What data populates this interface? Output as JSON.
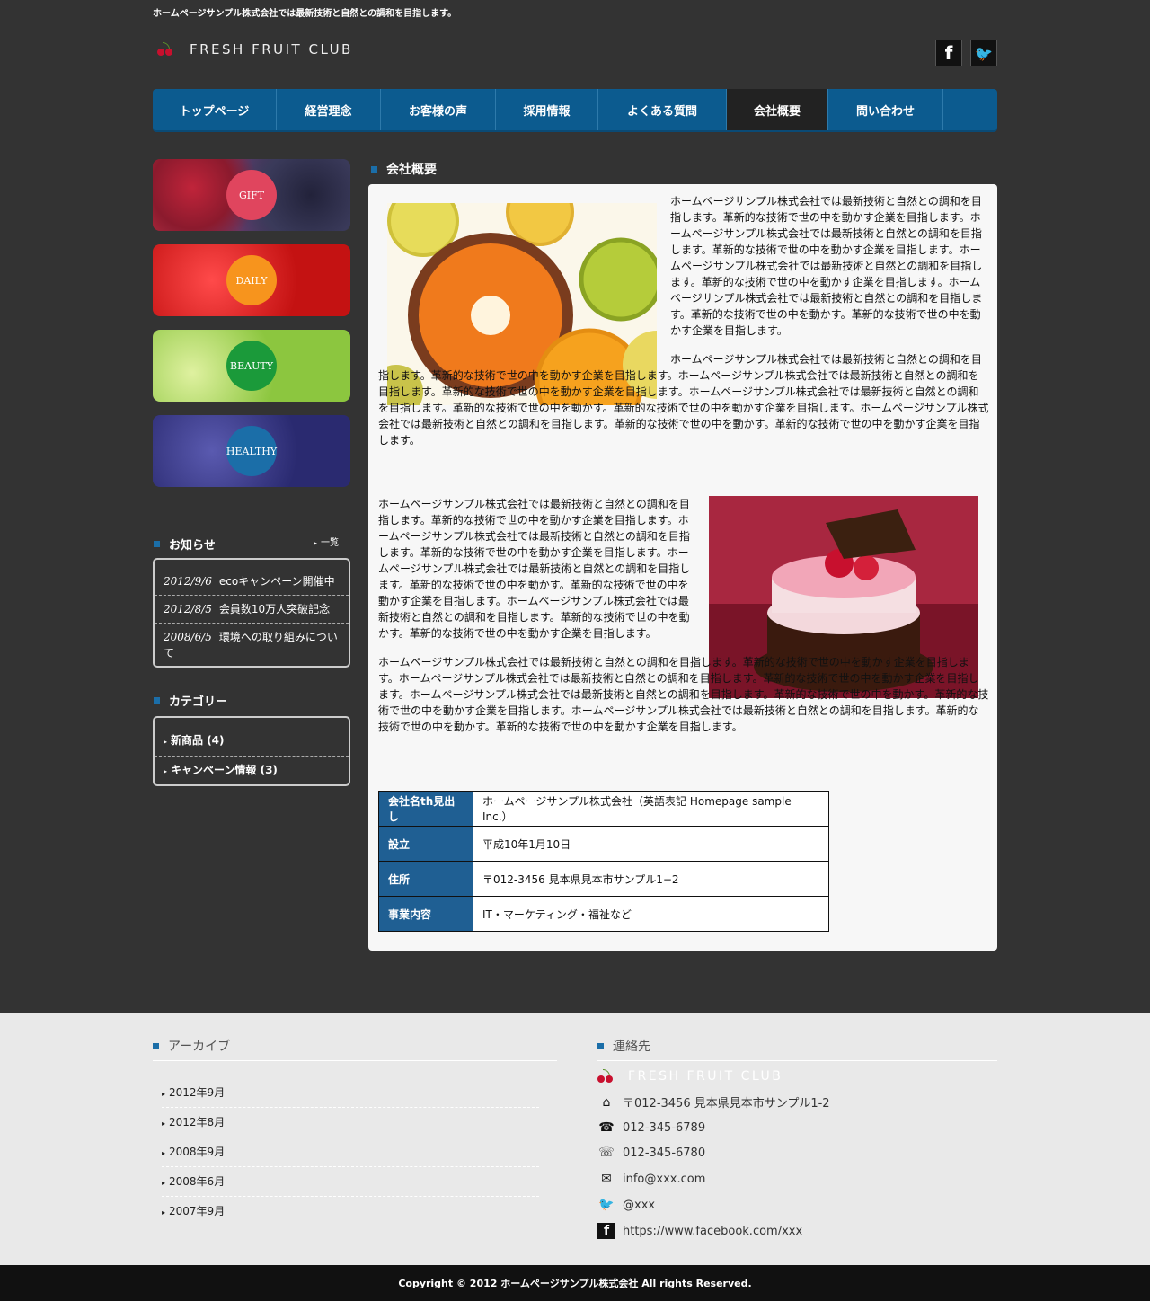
{
  "header": {
    "tagline": "ホームページサンプル株式会社では最新技術と自然との調和を目指します。",
    "logo": "FRESH FRUIT CLUB",
    "facebook": "f",
    "twitter": "🐦"
  },
  "nav": [
    {
      "label": "トップページ",
      "w": 138
    },
    {
      "label": "経営理念",
      "w": 116
    },
    {
      "label": "お客様の声",
      "w": 128
    },
    {
      "label": "採用情報",
      "w": 114
    },
    {
      "label": "よくある質問",
      "w": 143
    },
    {
      "label": "会社概要",
      "w": 113
    },
    {
      "label": "問い合わせ",
      "w": 128
    }
  ],
  "banners": {
    "gift": "GIFT",
    "daily": "DAILY",
    "beauty": "BEAUTY",
    "healthy": "HEALTHY"
  },
  "news": {
    "title": "お知らせ",
    "more": "一覧",
    "items": [
      {
        "date": "2012/9/6",
        "text": "ecoキャンペーン開催中"
      },
      {
        "date": "2012/8/5",
        "text": "会員数10万人突破記念"
      },
      {
        "date": "2008/6/5",
        "text": "環境への取り組みについて"
      }
    ]
  },
  "category": {
    "title": "カテゴリー",
    "items": [
      "新商品 (4)",
      "キャンペーン情報 (3)"
    ]
  },
  "main": {
    "title": "会社概要",
    "p1": "ホームページサンプル株式会社では最新技術と自然との調和を目指します。革新的な技術で世の中を動かす企業を目指します。ホームページサンプル株式会社では最新技術と自然との調和を目指します。革新的な技術で世の中を動かす企業を目指します。ホームページサンプル株式会社では最新技術と自然との調和を目指します。革新的な技術で世の中を動かす企業を目指します。ホームページサンプル株式会社では最新技術と自然との調和を目指します。革新的な技術で世の中を動かす。革新的な技術で世の中を動かす企業を目指します。",
    "p2": "ホームページサンプル株式会社では最新技術と自然との調和を目指します。革新的な技術で世の中を動かす企業を目指します。ホームページサンプル株式会社では最新技術と自然との調和を目指します。革新的な技術で世の中を動かす企業を目指します。ホームページサンプル株式会社では最新技術と自然との調和を目指します。革新的な技術で世の中を動かす。革新的な技術で世の中を動かす企業を目指します。ホームページサンプル株式会社では最新技術と自然との調和を目指します。革新的な技術で世の中を動かす。革新的な技術で世の中を動かす企業を目指します。",
    "p3": "ホームページサンプル株式会社では最新技術と自然との調和を目指します。革新的な技術で世の中を動かす企業を目指します。ホームページサンプル株式会社では最新技術と自然との調和を目指します。革新的な技術で世の中を動かす企業を目指します。ホームページサンプル株式会社では最新技術と自然との調和を目指します。革新的な技術で世の中を動かす。革新的な技術で世の中を動かす企業を目指します。ホームページサンプル株式会社では最新技術と自然との調和を目指します。革新的な技術で世の中を動かす。革新的な技術で世の中を動かす企業を目指します。",
    "p4": "ホームページサンプル株式会社では最新技術と自然との調和を目指します。革新的な技術で世の中を動かす企業を目指します。ホームページサンプル株式会社では最新技術と自然との調和を目指します。革新的な技術で世の中を動かす企業を目指します。ホームページサンプル株式会社では最新技術と自然との調和を目指します。革新的な技術で世の中を動かす。革新的な技術で世の中を動かす企業を目指します。ホームページサンプル株式会社では最新技術と自然との調和を目指します。革新的な技術で世の中を動かす。革新的な技術で世の中を動かす企業を目指します。",
    "table": [
      {
        "th": "会社名th見出し",
        "td": "ホームページサンプル株式会社（英語表記 Homepage sample Inc.）"
      },
      {
        "th": "設立",
        "td": "平成10年1月10日"
      },
      {
        "th": "住所",
        "td": "〒012-3456 見本県見本市サンプル1−2"
      },
      {
        "th": "事業内容",
        "td": "IT・マーケティング・福祉など"
      }
    ]
  },
  "footer": {
    "archive_title": "アーカイブ",
    "archives": [
      "2012年9月",
      "2012年8月",
      "2008年9月",
      "2008年6月",
      "2007年9月"
    ],
    "contact_title": "連絡先",
    "contact_logo": "FRESH FRUIT CLUB",
    "address": "〒012-3456 見本県見本市サンプル1-2",
    "tel": "012-345-6789",
    "fax": "012-345-6780",
    "email": "info@xxx.com",
    "twitter": "@xxx",
    "facebook": "https://www.facebook.com/xxx"
  },
  "copyright": "Copyright © 2012 ホームページサンプル株式会社 All rights Reserved."
}
